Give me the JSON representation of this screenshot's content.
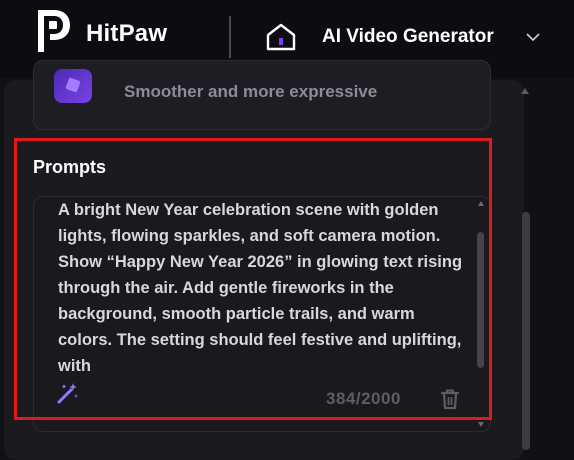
{
  "header": {
    "brand": "HitPaw",
    "nav_title": "AI Video Generator"
  },
  "model_card": {
    "description": "Smoother and more expressive"
  },
  "prompts": {
    "title": "Prompts",
    "text": "A bright New Year celebration scene with golden lights, flowing sparkles, and soft camera motion. Show “Happy New Year 2026” in glowing text rising through the air. Add gentle fireworks in the background, smooth particle trails, and warm colors. The setting should feel festive and uplifting, with",
    "counter": "384/2000"
  },
  "colors": {
    "accent_purple": "#7a43e6",
    "highlight_red": "#e0191f",
    "background": "#111014"
  },
  "icons": {
    "logo": "hitpaw-logo-icon",
    "home": "home-icon",
    "dropdown": "chevron-down-icon",
    "magic": "magic-wand-icon",
    "delete": "trash-icon"
  }
}
